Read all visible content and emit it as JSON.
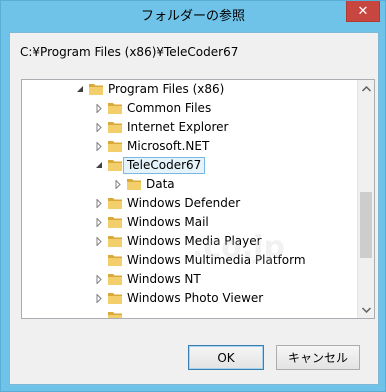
{
  "window": {
    "title": "フォルダーの参照",
    "close_label": "✕"
  },
  "path_label": "C:¥Program Files (x86)¥TeleCoder67",
  "tree": {
    "items": [
      {
        "label": "Program Files (x86)",
        "expanded": true,
        "selected": false
      },
      {
        "label": "Common Files",
        "expanded": false,
        "selected": false
      },
      {
        "label": "Internet Explorer",
        "expanded": false,
        "selected": false
      },
      {
        "label": "Microsoft.NET",
        "expanded": false,
        "selected": false
      },
      {
        "label": "TeleCoder67",
        "expanded": true,
        "selected": true
      },
      {
        "label": "Data",
        "expanded": false,
        "selected": false
      },
      {
        "label": "Windows Defender",
        "expanded": false,
        "selected": false
      },
      {
        "label": "Windows Mail",
        "expanded": false,
        "selected": false
      },
      {
        "label": "Windows Media Player",
        "expanded": false,
        "selected": false
      },
      {
        "label": "Windows Multimedia Platform",
        "expanded": false,
        "selected": false
      },
      {
        "label": "Windows NT",
        "expanded": false,
        "selected": false
      },
      {
        "label": "Windows Photo Viewer",
        "expanded": false,
        "selected": false
      }
    ]
  },
  "buttons": {
    "ok_label": "OK",
    "cancel_label": "キャンセル"
  },
  "watermark_text": ".co.jp",
  "colors": {
    "frame": "#6fc3e8",
    "close_button": "#c7463f",
    "selection_bg": "#e5f3fb",
    "selection_border": "#7ab8e0",
    "folder": "#e8c35a"
  }
}
